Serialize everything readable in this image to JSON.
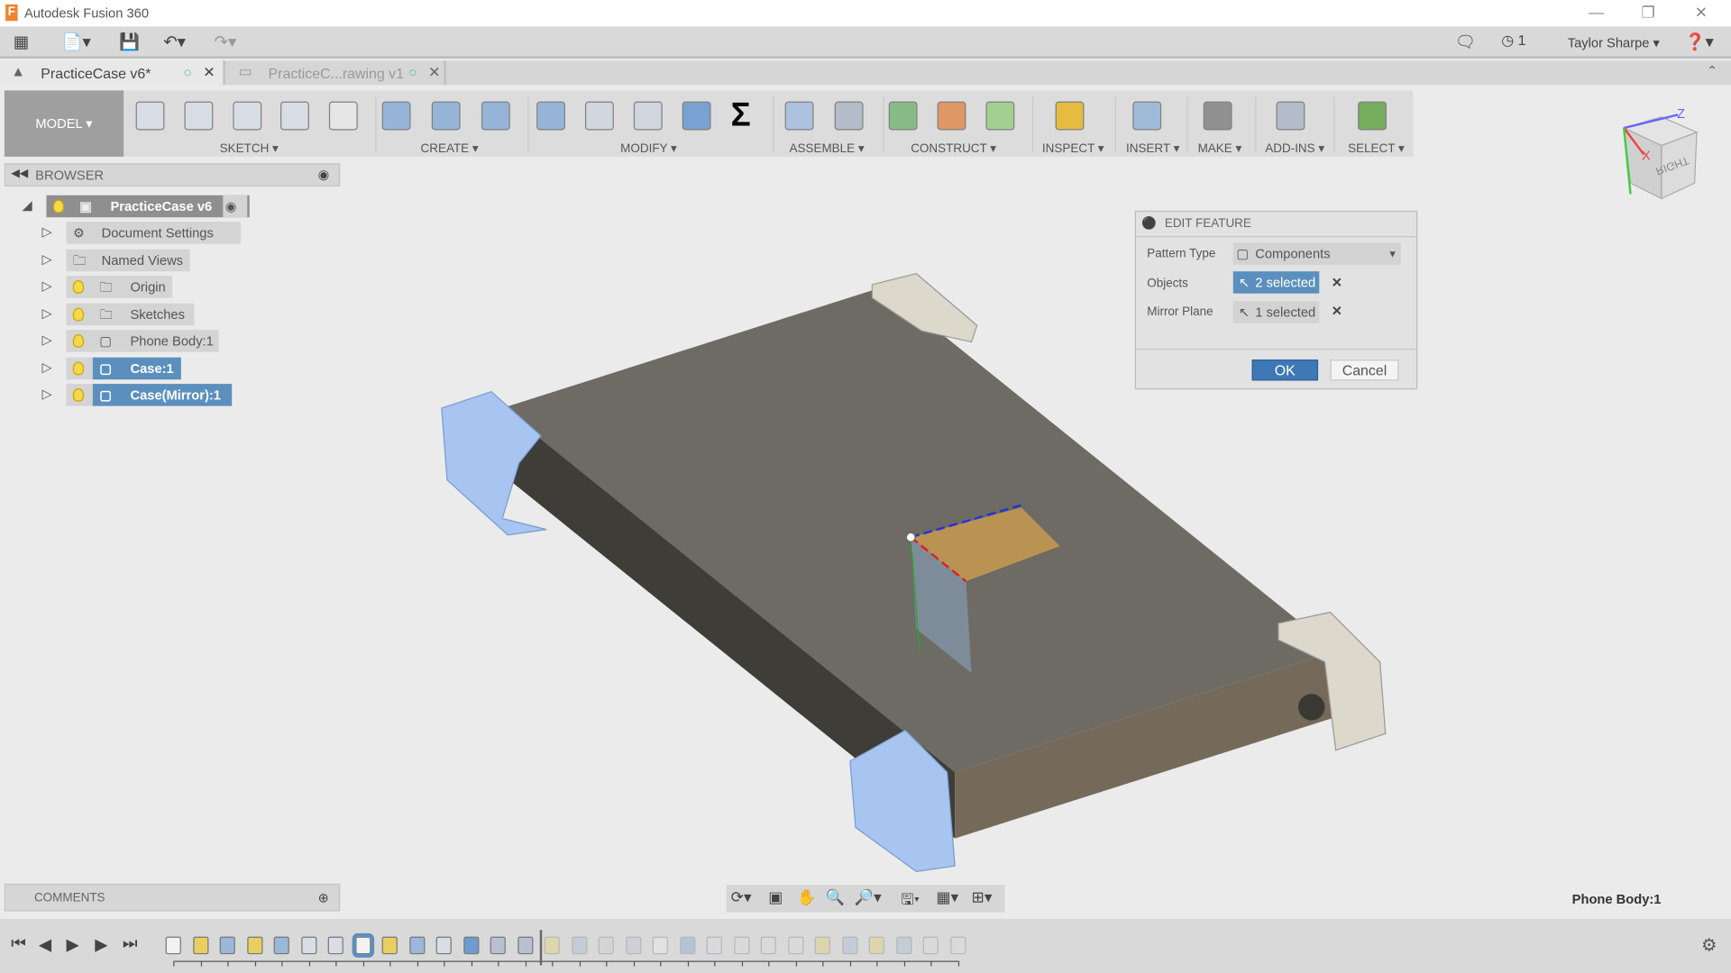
{
  "window": {
    "title": "Autodesk Fusion 360"
  },
  "qat": {
    "user": "Taylor Sharpe",
    "jobs_count": "1"
  },
  "tabs": [
    {
      "label": "PracticeCase v6*"
    },
    {
      "label": "PracticeC...rawing v1"
    }
  ],
  "toolbar": {
    "workspace": "MODEL ▾",
    "groups": [
      "SKETCH ▾",
      "CREATE ▾",
      "MODIFY ▾",
      "ASSEMBLE ▾",
      "CONSTRUCT ▾",
      "INSPECT ▾",
      "INSERT ▾",
      "MAKE ▾",
      "ADD-INS ▾",
      "SELECT ▾"
    ]
  },
  "browser": {
    "title": "BROWSER",
    "root": "PracticeCase v6",
    "items": [
      {
        "label": "Document Settings",
        "icon": "gear",
        "bulb": false,
        "selected": false
      },
      {
        "label": "Named Views",
        "icon": "folder",
        "bulb": false,
        "selected": false
      },
      {
        "label": "Origin",
        "icon": "folder",
        "bulb": true,
        "selected": false
      },
      {
        "label": "Sketches",
        "icon": "folder",
        "bulb": true,
        "selected": false
      },
      {
        "label": "Phone Body:1",
        "icon": "body",
        "bulb": true,
        "selected": false
      },
      {
        "label": "Case:1",
        "icon": "body",
        "bulb": true,
        "selected": true
      },
      {
        "label": "Case(Mirror):1",
        "icon": "body",
        "bulb": true,
        "selected": true
      }
    ]
  },
  "dialog": {
    "title": "EDIT FEATURE",
    "pattern_type_label": "Pattern Type",
    "pattern_type_value": "Components",
    "objects_label": "Objects",
    "objects_value": "2 selected",
    "mirror_label": "Mirror Plane",
    "mirror_value": "1 selected",
    "ok": "OK",
    "cancel": "Cancel"
  },
  "viewcube": {
    "face": "RIGHT",
    "axis_z": "Z",
    "axis_x": "X"
  },
  "comments": {
    "title": "COMMENTS"
  },
  "status": {
    "selection": "Phone Body:1"
  },
  "timeline": {
    "items": [
      "body",
      "sketch",
      "extrude",
      "sketch",
      "extrude",
      "fillet",
      "fillet",
      "body",
      "sketch",
      "extrude",
      "fillet",
      "combine",
      "mirror",
      "mirror",
      "sketch",
      "extrude",
      "joint",
      "mirror",
      "body",
      "combine",
      "fillet",
      "fillet",
      "fillet",
      "fillet",
      "sketch",
      "extrude",
      "sketch",
      "extrude",
      "fillet",
      "fillet"
    ],
    "current_index": 7,
    "marker_index": 13
  },
  "colors": {
    "accent": "#5b8fbe",
    "selection": "#a8c4f0",
    "body": "#6b6b63"
  }
}
